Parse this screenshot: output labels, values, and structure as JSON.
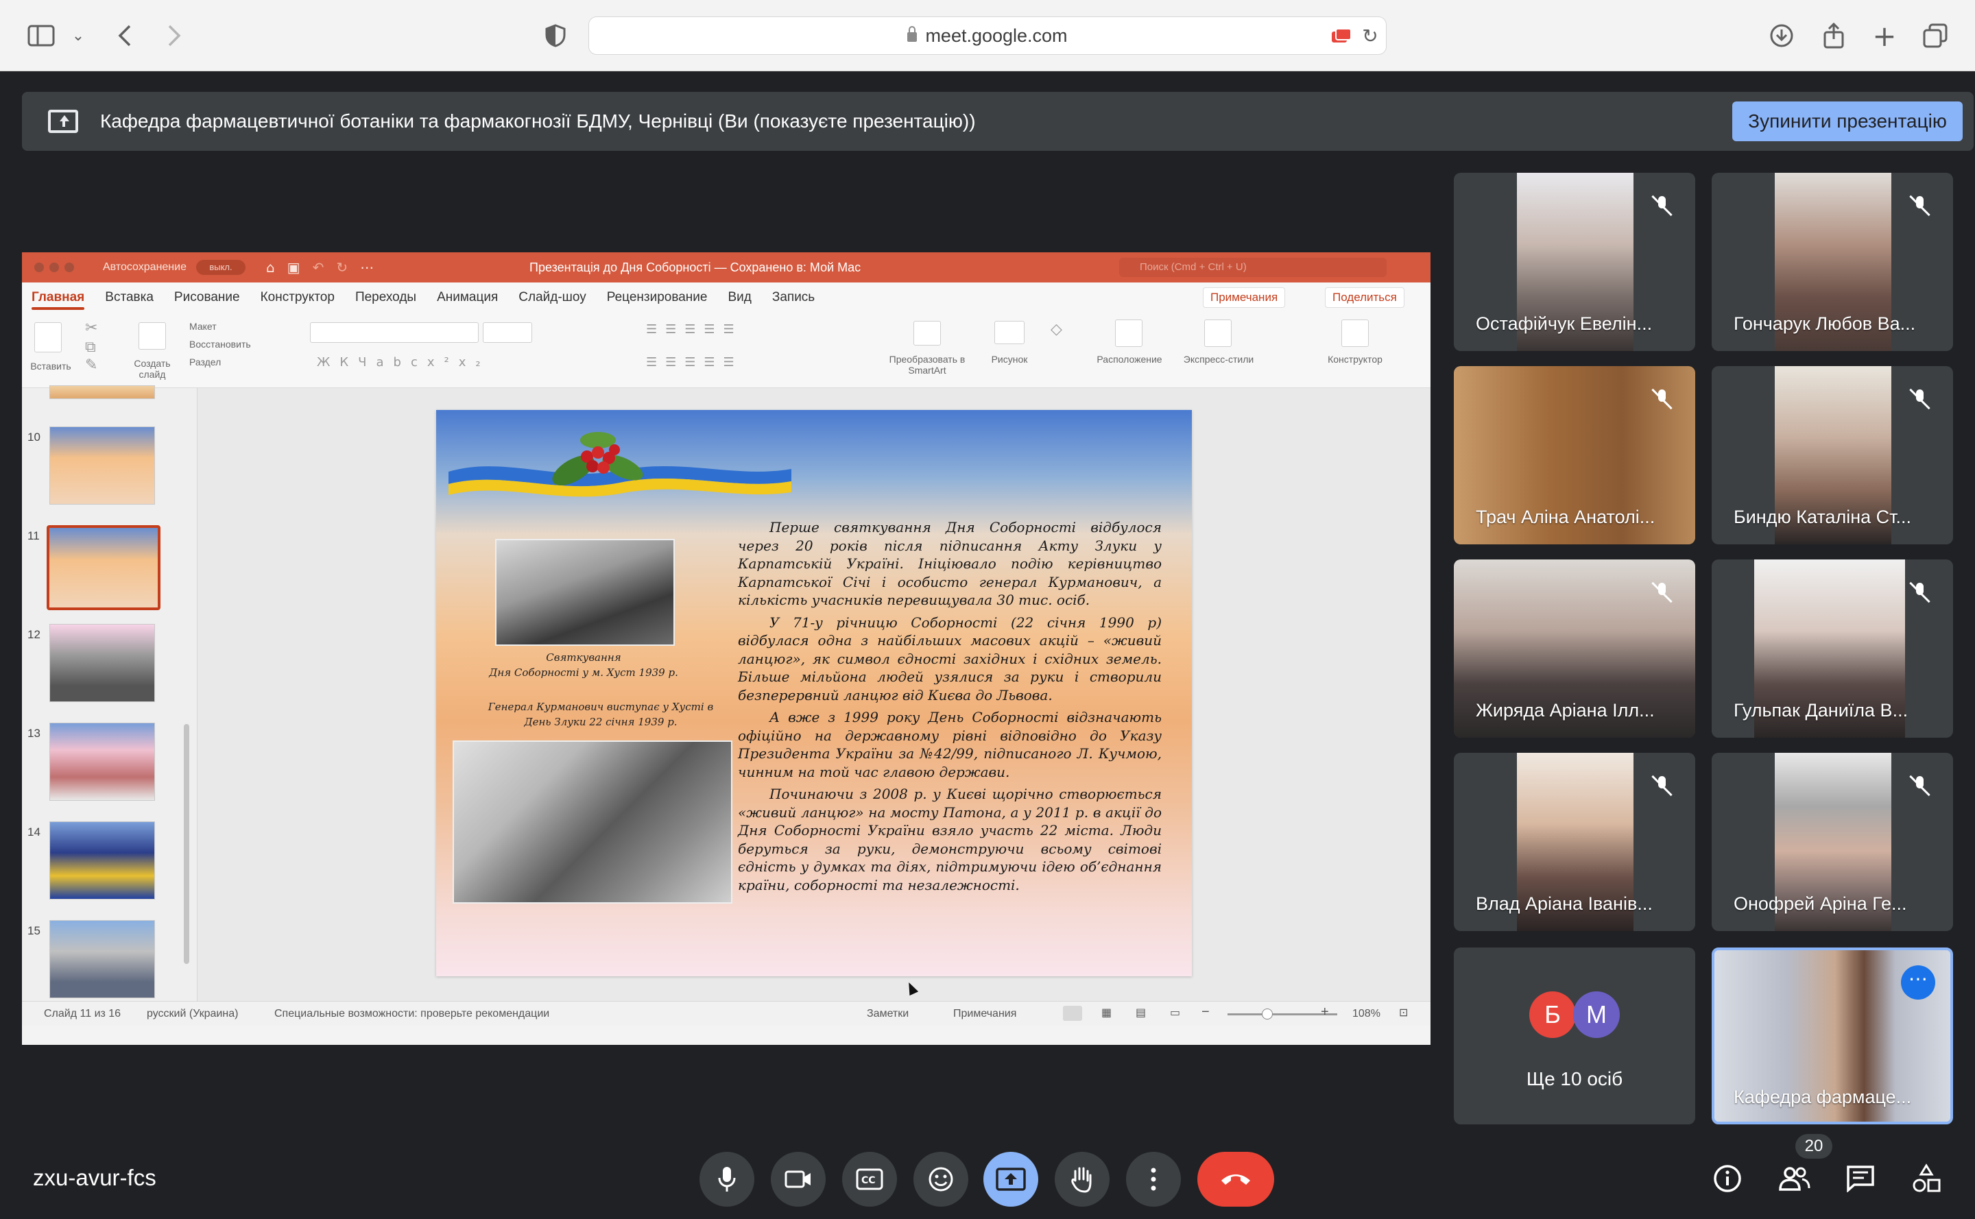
{
  "browser": {
    "url": "meet.google.com",
    "icons": [
      "sidebar-icon",
      "chevron-down-icon",
      "back-icon",
      "forward-icon",
      "shield-icon",
      "lock-icon",
      "reload-icon",
      "download-icon",
      "share-icon",
      "new-tab-icon",
      "tabs-icon"
    ]
  },
  "banner": {
    "text": "Кафедра фармацевтичної ботаніки та фармакогнозії БДМУ, Чернівці (Ви (показуєте презентацію))",
    "stop_label": "Зупинити презентацію"
  },
  "ppt": {
    "autosave_label": "Автосохранение",
    "autosave_state": "выкл.",
    "doc_title": "Презентація до Дня Соборності — Сохранено в: Мой Mac",
    "search_placeholder": "Поиск (Cmd + Ctrl + U)",
    "tabs": [
      "Главная",
      "Вставка",
      "Рисование",
      "Конструктор",
      "Переходы",
      "Анимация",
      "Слайд-шоу",
      "Рецензирование",
      "Вид",
      "Запись"
    ],
    "comments_label": "Примечания",
    "share_label": "Поделиться",
    "ribbon": {
      "paste": "Вставить",
      "new_slide": "Создать слайд",
      "layout": "Макет",
      "reset": "Восстановить",
      "section": "Раздел",
      "smartart": "Преобразовать в SmartArt",
      "picture": "Рисунок",
      "arrange": "Расположение",
      "quick_styles": "Экспресс-стили",
      "designer": "Конструктор"
    },
    "thumbnails": [
      {
        "num": "10",
        "selected": false
      },
      {
        "num": "11",
        "selected": true
      },
      {
        "num": "12",
        "selected": false
      },
      {
        "num": "13",
        "selected": false
      },
      {
        "num": "14",
        "selected": false
      },
      {
        "num": "15",
        "selected": false
      }
    ],
    "slide": {
      "paragraphs": [
        "Перше святкування Дня Соборності відбулося через 20 років після підписання Акту Злуки у Карпатській Україні. Ініціювало подію керівництво Карпатської Січі і особисто генерал Курманович, а кількість учасників перевищувала 30 тис. осіб.",
        "У 71-у річницю Соборності (22 січня 1990 р) відбулася одна з найбільших масових акцій – «живий ланцюг», як символ єдності західних і східних земель. Більше мільйона людей узялися за руки і створили безперервний ланцюг від Києва до Львова.",
        "А вже з 1999 року День Соборності відзначають офіційно на державному рівні відповідно до Указу Президента України за №42/99, підписаного Л. Кучмою, чинним на той час главою держави.",
        "Починаючи з 2008 р. у Києві щорічно створюється «живий ланцюг» на мосту Патона, а у 2011 р. в акції до Дня Соборності України взяло участь 22 міста. Люди беруться за руки, демонструючи всьому світові єдність у думках та діях, підтримуючи ідею об’єднання країни, соборності та незалежності."
      ],
      "caption1_line1": "Святкування",
      "caption1_line2": "Дня Соборності у м. Хуст 1939 р.",
      "caption2": "Генерал Курманович виступає у Хусті в День Злуки 22 січня 1939 р."
    },
    "status": {
      "slide_of": "Слайд 11 из 16",
      "language": "русский (Украина)",
      "accessibility": "Специальные возможности: проверьте рекомендации",
      "notes": "Заметки",
      "comments": "Примечания",
      "zoom": "108%"
    }
  },
  "participants": [
    {
      "name": "Остафійчук Евелін...",
      "muted": true
    },
    {
      "name": "Гончарук Любов Ва...",
      "muted": true
    },
    {
      "name": "Трач Аліна Анатолі...",
      "muted": true
    },
    {
      "name": "Биндю Каталіна Ст...",
      "muted": true
    },
    {
      "name": "Жиряда Аріана Ілл...",
      "muted": true
    },
    {
      "name": "Гульпак Даниїла В...",
      "muted": true
    },
    {
      "name": "Влад Аріана Іванів...",
      "muted": true
    },
    {
      "name": "Онофрей Аріна Ге...",
      "muted": true
    }
  ],
  "more_tile": {
    "avatar1": "Б",
    "avatar2": "М",
    "label": "Ще 10 осіб",
    "avatar1_color": "#e8453c",
    "avatar2_color": "#6b5fc4"
  },
  "self_tile": {
    "name": "Кафедра фармаце..."
  },
  "bottom": {
    "meeting_code": "zxu-avur-fcs",
    "people_count": "20",
    "controls": [
      "mic-icon",
      "camera-icon",
      "captions-icon",
      "emoji-icon",
      "present-icon",
      "raise-hand-icon",
      "more-options-icon",
      "leave-call-icon"
    ],
    "right_icons": [
      "info-icon",
      "people-icon",
      "chat-icon",
      "activities-icon"
    ]
  },
  "colors": {
    "meet_bg": "#202124",
    "tile_bg": "#3c4043",
    "accent": "#8ab4f8",
    "leave": "#ea4335",
    "ppt_brand": "#c43e1c"
  }
}
